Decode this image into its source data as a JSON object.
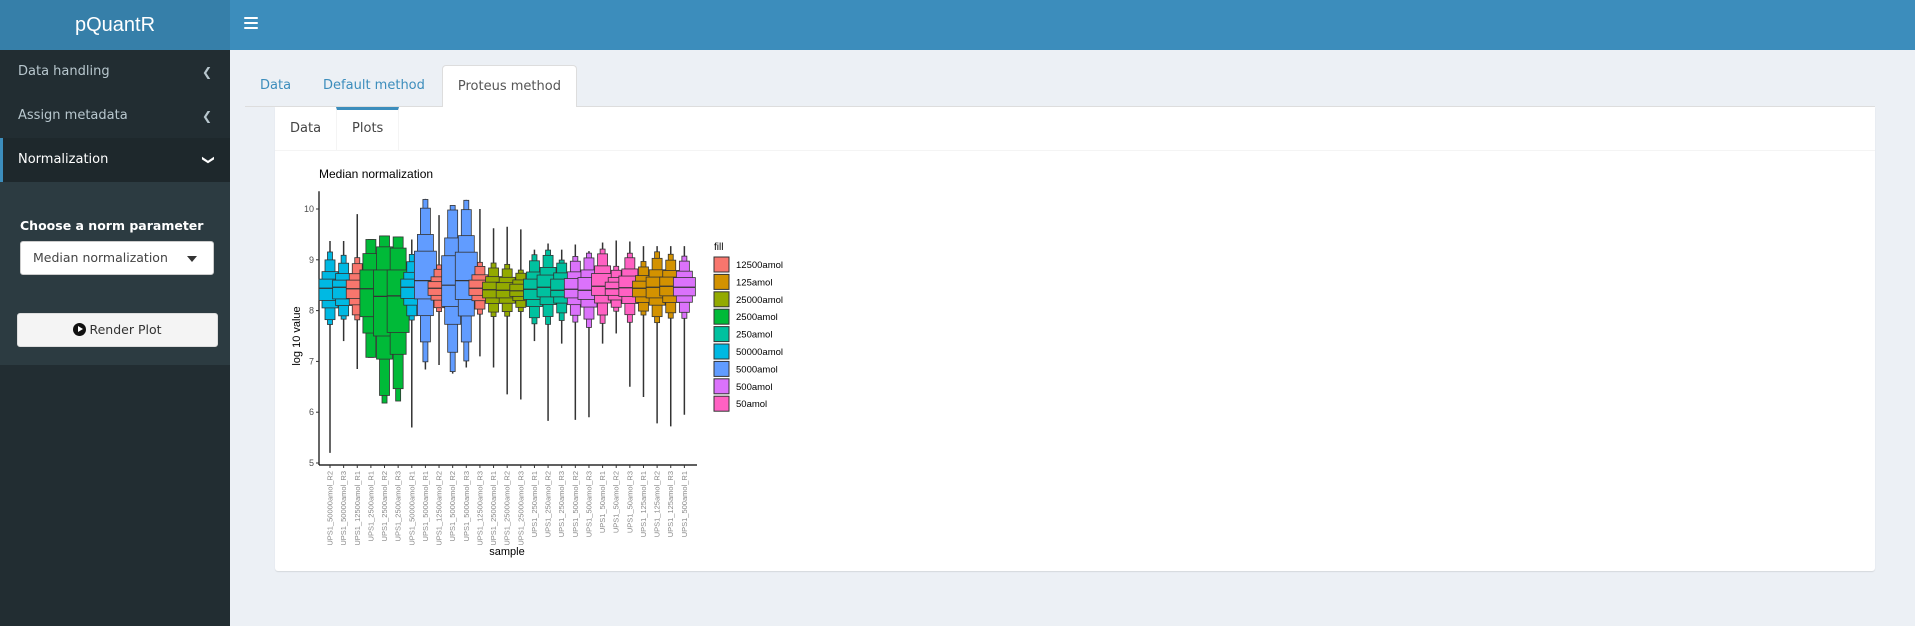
{
  "app": {
    "title": "pQuantR"
  },
  "header": {
    "menu_icon": "hamburger-icon"
  },
  "sidebar": {
    "items": [
      {
        "label": "Data handling",
        "icon": "chevron-left-icon",
        "expanded": false
      },
      {
        "label": "Assign metadata",
        "icon": "chevron-left-icon",
        "expanded": false
      },
      {
        "label": "Normalization",
        "icon": "chevron-down-icon",
        "expanded": true
      }
    ],
    "norm_param_label": "Choose a norm parameter",
    "norm_param_value": "Median normalization",
    "render_button": "Render Plot"
  },
  "tabs": {
    "outer": [
      "Data",
      "Default method",
      "Proteus method"
    ],
    "outer_active": 2,
    "inner": [
      "Data",
      "Plots"
    ],
    "inner_active": 1
  },
  "chart_data": {
    "type": "boxen",
    "title": "Median normalization",
    "xlabel": "sample",
    "ylabel": "log 10 value",
    "ylim": [
      5,
      10.3
    ],
    "yticks": [
      5,
      6,
      7,
      8,
      9,
      10
    ],
    "legend": {
      "title": "fill",
      "position": "right",
      "entries": [
        {
          "name": "12500amol",
          "color": "#F8766D"
        },
        {
          "name": "125amol",
          "color": "#D39200"
        },
        {
          "name": "25000amol",
          "color": "#93AA00"
        },
        {
          "name": "2500amol",
          "color": "#00BA38"
        },
        {
          "name": "250amol",
          "color": "#00C19F"
        },
        {
          "name": "50000amol",
          "color": "#00B9E3"
        },
        {
          "name": "5000amol",
          "color": "#619CFF"
        },
        {
          "name": "500amol",
          "color": "#DB72FB"
        },
        {
          "name": "50amol",
          "color": "#FF61C3"
        }
      ]
    },
    "samples": [
      {
        "name": "UPS1_50000amol_R2",
        "group": "50000amol",
        "min": 5.2,
        "q1": 8.2,
        "median": 8.44,
        "q3": 8.62,
        "max": 9.37
      },
      {
        "name": "UPS1_50000amol_R3",
        "group": "50000amol",
        "min": 7.4,
        "q1": 8.23,
        "median": 8.46,
        "q3": 8.6,
        "max": 9.37
      },
      {
        "name": "UPS1_12500amol_R1",
        "group": "12500amol",
        "min": 6.85,
        "q1": 8.24,
        "median": 8.43,
        "q3": 8.6,
        "max": 9.9
      },
      {
        "name": "UPS1_2500amol_R1",
        "group": "2500amol",
        "min": 7.08,
        "q1": 7.88,
        "median": 8.43,
        "q3": 8.8,
        "max": 9.4
      },
      {
        "name": "UPS1_2500amol_R2",
        "group": "2500amol",
        "min": 6.18,
        "q1": 7.5,
        "median": 8.28,
        "q3": 8.8,
        "max": 9.47
      },
      {
        "name": "UPS1_2500amol_R3",
        "group": "2500amol",
        "min": 6.22,
        "q1": 7.57,
        "median": 8.29,
        "q3": 8.8,
        "max": 9.45
      },
      {
        "name": "UPS1_50000amol_R1",
        "group": "50000amol",
        "min": 5.7,
        "q1": 8.24,
        "median": 8.46,
        "q3": 8.62,
        "max": 9.4
      },
      {
        "name": "UPS1_5000amol_R1",
        "group": "5000amol",
        "min": 6.84,
        "q1": 8.23,
        "median": 8.59,
        "q3": 9.17,
        "max": 10.2
      },
      {
        "name": "UPS1_12500amol_R2",
        "group": "12500amol",
        "min": 6.93,
        "q1": 8.3,
        "median": 8.44,
        "q3": 8.57,
        "max": 9.88
      },
      {
        "name": "UPS1_5000amol_R2",
        "group": "5000amol",
        "min": 6.76,
        "q1": 8.08,
        "median": 8.5,
        "q3": 9.08,
        "max": 10.07
      },
      {
        "name": "UPS1_5000amol_R3",
        "group": "5000amol",
        "min": 6.88,
        "q1": 8.22,
        "median": 8.59,
        "q3": 9.15,
        "max": 10.18
      },
      {
        "name": "UPS1_12500amol_R3",
        "group": "12500amol",
        "min": 7.1,
        "q1": 8.3,
        "median": 8.44,
        "q3": 8.6,
        "max": 10.0
      },
      {
        "name": "UPS1_25000amol_R1",
        "group": "25000amol",
        "min": 6.88,
        "q1": 8.25,
        "median": 8.41,
        "q3": 8.56,
        "max": 9.62
      },
      {
        "name": "UPS1_25000amol_R2",
        "group": "25000amol",
        "min": 6.35,
        "q1": 8.25,
        "median": 8.4,
        "q3": 8.55,
        "max": 9.65
      },
      {
        "name": "UPS1_25000amol_R3",
        "group": "25000amol",
        "min": 6.25,
        "q1": 8.28,
        "median": 8.39,
        "q3": 8.52,
        "max": 9.6
      },
      {
        "name": "UPS1_250amol_R1",
        "group": "250amol",
        "min": 7.4,
        "q1": 8.22,
        "median": 8.42,
        "q3": 8.62,
        "max": 9.2
      },
      {
        "name": "UPS1_250amol_R2",
        "group": "250amol",
        "min": 5.83,
        "q1": 8.27,
        "median": 8.46,
        "q3": 8.7,
        "max": 9.32
      },
      {
        "name": "UPS1_250amol_R3",
        "group": "250amol",
        "min": 7.35,
        "q1": 8.27,
        "median": 8.4,
        "q3": 8.62,
        "max": 9.2
      },
      {
        "name": "UPS1_500amol_R2",
        "group": "500amol",
        "min": 5.85,
        "q1": 8.25,
        "median": 8.42,
        "q3": 8.63,
        "max": 9.3
      },
      {
        "name": "UPS1_500amol_R3",
        "group": "500amol",
        "min": 5.9,
        "q1": 8.22,
        "median": 8.4,
        "q3": 8.65,
        "max": 9.17
      },
      {
        "name": "UPS1_50amol_R1",
        "group": "50amol",
        "min": 7.35,
        "q1": 8.3,
        "median": 8.48,
        "q3": 8.73,
        "max": 9.34
      },
      {
        "name": "UPS1_50amol_R2",
        "group": "50amol",
        "min": 7.55,
        "q1": 8.3,
        "median": 8.43,
        "q3": 8.56,
        "max": 9.38
      },
      {
        "name": "UPS1_50amol_R3",
        "group": "50amol",
        "min": 6.5,
        "q1": 8.28,
        "median": 8.45,
        "q3": 8.68,
        "max": 9.36
      },
      {
        "name": "UPS1_125amol_R1",
        "group": "125amol",
        "min": 6.3,
        "q1": 8.27,
        "median": 8.44,
        "q3": 8.58,
        "max": 9.27
      },
      {
        "name": "UPS1_125amol_R2",
        "group": "125amol",
        "min": 5.78,
        "q1": 8.25,
        "median": 8.46,
        "q3": 8.66,
        "max": 9.27
      },
      {
        "name": "UPS1_125amol_R3",
        "group": "125amol",
        "min": 5.72,
        "q1": 8.29,
        "median": 8.48,
        "q3": 8.66,
        "max": 9.27
      },
      {
        "name": "UPS1_500amol_R1",
        "group": "500amol",
        "min": 5.95,
        "q1": 8.29,
        "median": 8.46,
        "q3": 8.65,
        "max": 9.27
      }
    ]
  }
}
